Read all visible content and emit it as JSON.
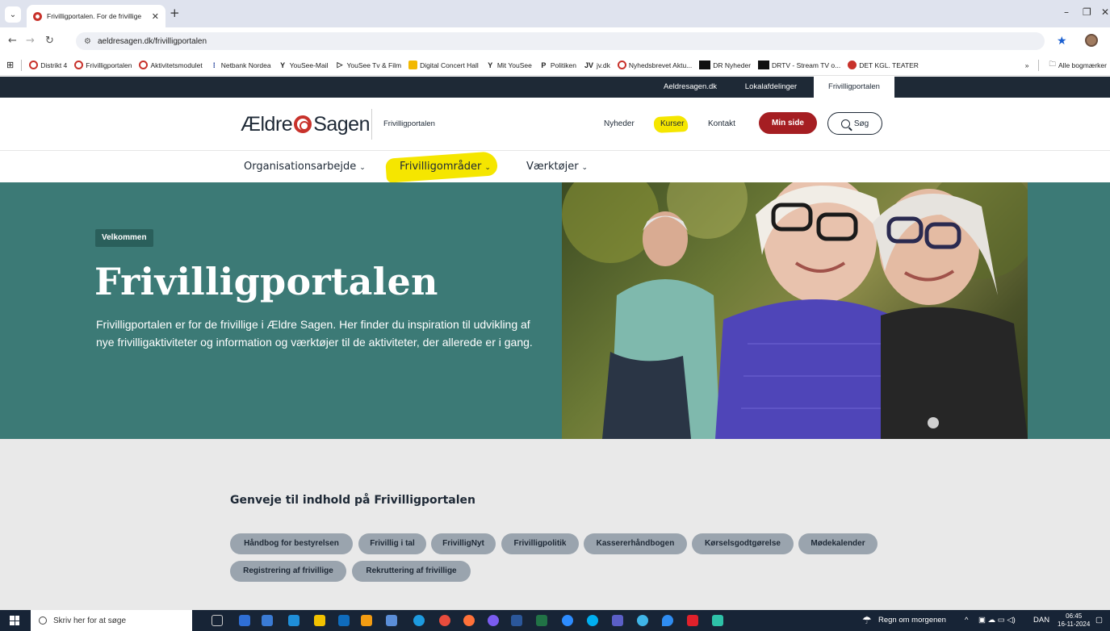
{
  "browser": {
    "tab_title": "Frivilligportalen. For de frivillige",
    "tab_close": "✕",
    "new_tab": "+",
    "url": "aeldresagen.dk/frivilligportalen",
    "bookmarks": [
      {
        "label": "Distrikt 4",
        "icon": "aeldresagen-icon"
      },
      {
        "label": "Frivilligportalen",
        "icon": "aeldresagen-icon"
      },
      {
        "label": "Aktivitetsmodulet",
        "icon": "aeldresagen-icon"
      },
      {
        "label": "Netbank Nordea",
        "icon": "nordea-icon"
      },
      {
        "label": "YouSee-Mail",
        "icon": "yousee-icon"
      },
      {
        "label": "YouSee Tv & Film",
        "icon": "play-icon"
      },
      {
        "label": "Digital Concert Hall",
        "icon": "concert-icon"
      },
      {
        "label": "Mit YouSee",
        "icon": "yousee-icon"
      },
      {
        "label": "Politiken",
        "icon": "politiken-icon"
      },
      {
        "label": "jv.dk",
        "icon": "jv-icon"
      },
      {
        "label": "Nyhedsbrevet Aktu...",
        "icon": "aeldresagen-icon"
      },
      {
        "label": "DR Nyheder",
        "icon": "dr-icon"
      },
      {
        "label": "DRTV - Stream TV o...",
        "icon": "dr-icon"
      },
      {
        "label": "DET KGL. TEATER",
        "icon": "teater-icon"
      }
    ],
    "bookmarks_more": "»",
    "all_bookmarks": "Alle bogmærker"
  },
  "sitebar": {
    "links": [
      "Aeldresagen.dk",
      "Lokalafdelinger",
      "Frivilligportalen"
    ]
  },
  "header": {
    "logo_left": "Ældre",
    "logo_right": "Sagen",
    "portal_name": "Frivilligportalen",
    "nav": [
      "Nyheder",
      "Kurser",
      "Kontakt"
    ],
    "min_side": "Min side",
    "search": "Søg"
  },
  "mainnav": {
    "items": [
      "Organisationsarbejde",
      "Frivilligområder",
      "Værktøjer"
    ]
  },
  "hero": {
    "badge": "Velkommen",
    "title": "Frivilligportalen",
    "body": "Frivilligportalen er for de frivillige i Ældre Sagen. Her finder du inspiration til udvikling af nye frivilligaktiviteter og information og værktøjer til de aktiviteter, der allerede er i gang."
  },
  "shortcuts": {
    "title": "Genveje til indhold på Frivilligportalen",
    "chips": [
      "Håndbog for bestyrelsen",
      "Frivillig i tal",
      "FrivilligNyt",
      "Frivilligpolitik",
      "Kassererhåndbogen",
      "Kørselsgodtgørelse",
      "Mødekalender",
      "Registrering af frivillige",
      "Rekruttering af frivillige"
    ]
  },
  "taskbar": {
    "search_placeholder": "Skriv her for at søge",
    "weather": "Regn om morgenen",
    "language": "DAN",
    "time": "06:45",
    "date": "16-11-2024"
  },
  "colors": {
    "brand_red": "#a51e22",
    "teal": "#3c7a76",
    "navy": "#1e2936",
    "highlight": "#f5e600"
  }
}
